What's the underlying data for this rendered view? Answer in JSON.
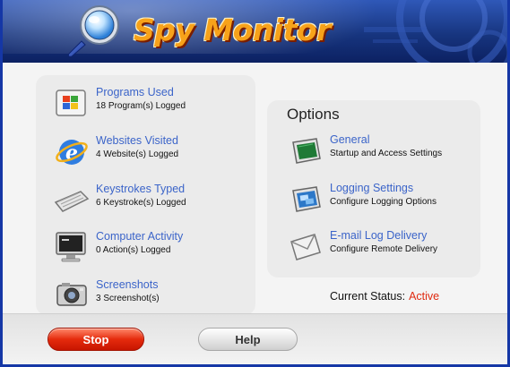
{
  "app": {
    "title": "Spy Monitor"
  },
  "logs": [
    {
      "label": "Programs Used",
      "detail": "18 Program(s) Logged",
      "icon": "windows-programs-icon"
    },
    {
      "label": "Websites Visited",
      "detail": "4 Website(s) Logged",
      "icon": "internet-explorer-icon"
    },
    {
      "label": "Keystrokes Typed",
      "detail": "6 Keystroke(s) Logged",
      "icon": "keyboard-icon"
    },
    {
      "label": "Computer Activity",
      "detail": "0 Action(s) Logged",
      "icon": "monitor-icon"
    },
    {
      "label": "Screenshots",
      "detail": "3 Screenshot(s)",
      "icon": "camera-icon"
    }
  ],
  "options": {
    "title": "Options",
    "items": [
      {
        "label": "General",
        "detail": "Startup and Access Settings",
        "icon": "general-settings-icon"
      },
      {
        "label": "Logging Settings",
        "detail": "Configure Logging Options",
        "icon": "logging-settings-icon"
      },
      {
        "label": "E-mail Log Delivery",
        "detail": "Configure Remote Delivery",
        "icon": "email-envelope-icon"
      }
    ]
  },
  "status": {
    "label": "Current Status:",
    "value": "Active"
  },
  "buttons": {
    "stop": "Stop",
    "help": "Help"
  },
  "colors": {
    "header_dark": "#17357f",
    "link_blue": "#3b64c9",
    "status_red": "#e02a10",
    "title_orange": "#f7a21a"
  }
}
